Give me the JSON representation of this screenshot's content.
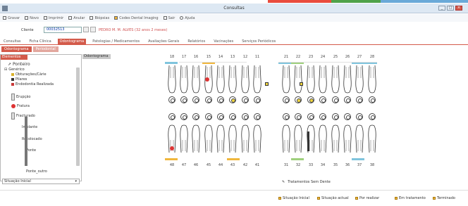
{
  "window": {
    "title": "Consultas"
  },
  "menu": [
    {
      "label": "Gravar",
      "icon": "save-icon"
    },
    {
      "label": "Novo",
      "icon": "new-icon"
    },
    {
      "label": "Imprimir",
      "icon": "print-icon"
    },
    {
      "label": "Anular",
      "icon": "cancel-icon"
    },
    {
      "label": "Biópsias",
      "icon": "biopsy-icon"
    },
    {
      "label": "Codes Dental Imaging",
      "icon": "imaging-icon"
    },
    {
      "label": "Sair",
      "icon": "exit-icon"
    },
    {
      "label": "Ajuda",
      "icon": "help-icon"
    }
  ],
  "client": {
    "label": "Cliente",
    "code": "00032513",
    "name": "PEDRO M. M. ALVES (32 anos 2 meses)"
  },
  "main_tabs": [
    {
      "label": "Consultas",
      "active": false
    },
    {
      "label": "Ficha Clínica",
      "active": false
    },
    {
      "label": "Odontograma",
      "active": true
    },
    {
      "label": "Patologias / Medicamentos",
      "active": false
    },
    {
      "label": "Avaliações Gerais",
      "active": false
    },
    {
      "label": "Relatórios",
      "active": false
    },
    {
      "label": "Vacinações",
      "active": false
    },
    {
      "label": "Serviços Periódicos",
      "active": false
    }
  ],
  "sub_tabs": [
    {
      "label": "Odontograma",
      "active": true
    },
    {
      "label": "Periodontal",
      "active": false
    }
  ],
  "left_panel": {
    "header": "Elementos",
    "tree": [
      {
        "label": "Ponteiro"
      },
      {
        "label": "Genérico"
      },
      {
        "label": "Obturações/Cárie",
        "color": "#d9b12a"
      },
      {
        "label": "Pilares",
        "color": "#333333"
      },
      {
        "label": "Endodontia Realizada",
        "color": "#c83838"
      },
      {
        "label": "Erupção"
      },
      {
        "label": "Fratura"
      },
      {
        "label": "Fracturado"
      },
      {
        "label": "Implante"
      },
      {
        "label": "Recolocado"
      },
      {
        "label": "Ponte"
      },
      {
        "label": "Ponte_outro"
      }
    ],
    "footer_select": "Situação Inicial"
  },
  "chart_header": "Odontograma",
  "upper_numbers": [
    "18",
    "17",
    "16",
    "15",
    "14",
    "13",
    "12",
    "11",
    "21",
    "22",
    "23",
    "24",
    "25",
    "26",
    "27",
    "28"
  ],
  "lower_numbers": [
    "48",
    "47",
    "46",
    "45",
    "44",
    "43",
    "42",
    "41",
    "31",
    "32",
    "33",
    "34",
    "35",
    "36",
    "37",
    "38"
  ],
  "no_dental_label": "Tratamentos Sem Dente",
  "legend": [
    {
      "label": "Situação Inicial"
    },
    {
      "label": "Situação actual"
    },
    {
      "label": "Por realizar"
    },
    {
      "label": "Em tratamento"
    },
    {
      "label": "Terminado"
    }
  ]
}
